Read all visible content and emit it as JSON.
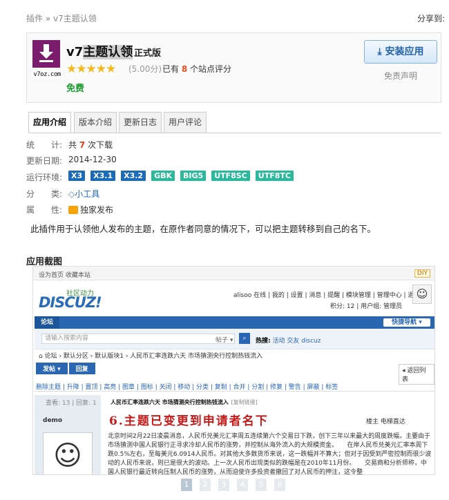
{
  "breadcrumb": "插件 » v7主题认领",
  "share_label": "分享到:",
  "plugin": {
    "logo_caption": "v7oz.com",
    "name_prefix": "v7",
    "name_highlight": "主题认领",
    "edition": "正式版",
    "rating_stars": "★★★★★",
    "rating": "(5.00分)",
    "rating_count_pre": "已有",
    "rating_count": "8",
    "rating_count_post": "个站点评分",
    "price": "免费",
    "install_label": "安装应用",
    "disclaimer": "免责声明",
    "colors": {
      "accent": "#2362a7",
      "free": "#1c9a2c",
      "star": "#f6b81a",
      "logo": "#7b1d6c"
    }
  },
  "tabs": [
    {
      "label": "应用介绍",
      "active": true
    },
    {
      "label": "版本介绍",
      "active": false
    },
    {
      "label": "更新日志",
      "active": false
    },
    {
      "label": "用户评论",
      "active": false
    }
  ],
  "info": {
    "stats_label": "统　　计:",
    "stats_pre": "共",
    "stats_count": "7",
    "stats_post": "次下载",
    "updated_label": "更新日期:",
    "updated": "2014-12-30",
    "env_label": "运行环境:",
    "env_tags": [
      "X3",
      "X3.1",
      "X3.2",
      "GBK",
      "BIG5",
      "UTF8SC",
      "UTF8TC"
    ],
    "category_label": "分　　类:",
    "category": "小工具",
    "attr_label": "属　　性:",
    "attr": "独家发布"
  },
  "description": "此插件用于认领他人发布的主题，在原作者同意的情况下，可以把主题转移到自己的名下。",
  "screenshots_title": "应用截图",
  "screenshot": {
    "top_left": "设为首页  收藏本站",
    "diy": "DIY",
    "logo_small": "社区动力",
    "logo_big": "DISCUZ!",
    "user_bar": "alisoo 在线 | 我的 | 设置 | 消息 | 提醒 | 模块管理 | 管理中心 | 退出",
    "user_bar2": "积分: 12  |  用户组: 管理员",
    "nav_item": "论坛",
    "quick_nav": "快捷导航 ▾",
    "search_placeholder": "请输入搜索内容",
    "search_select": "帖子 ▾",
    "hot_label": "热搜:",
    "hot_items": "活动  交友  discuz",
    "crumb": "论坛 › 默认分区 › 默认版块1 › 人民币汇率连跌六天 市场猜测央行控制热钱流入",
    "post_btn": "发帖 ▾",
    "reply_btn": "回复",
    "back_btn": "◂ 返回列表",
    "tools": "删除主题 | 升降 | 置顶 | 高亮 | 图章 | 图标 | 关闭 | 移动 | 分类 | 复制 | 合并 | 分割 | 修复 | 警告 | 屏蔽 | 标签",
    "side_stat": "查看: 13 | 回复: 1",
    "username": "demo",
    "post_title": "人民币汇率连跌六天 市场猜测央行控制热钱流入",
    "post_title_tag": "[复制链接]",
    "overlay": "6.主题已变更到申请者名下",
    "post_right": "楼主  电梯直达",
    "body": "北京时间2月22日凌晨消息，人民币兑美元汇率周五连续第六个交易日下跌，创下三年以来最大的周度跌幅，主要由于市场猜测中国人民银行正寻求冷却人民币的涨势，并控制从海外流入的大规模资金。　　在岸人民币兑美元汇率本周下跌0.5%左右，至每美元6.0914人民币。对其他大多数货币来说，这一跌幅并不算大；但对于因受到严密控制而很少波动的人民币来说，则已是很大的波动。上一次人民币出现类似的跌幅是在2010年11月份。　　交易商和分析师称，中国人民银行最近转向压制人民币的涨势，从而迫使许多投资者撤回了对人民币的押注，这令整"
  },
  "pager": [
    "1",
    "2",
    "3",
    "4",
    "5",
    "6"
  ]
}
